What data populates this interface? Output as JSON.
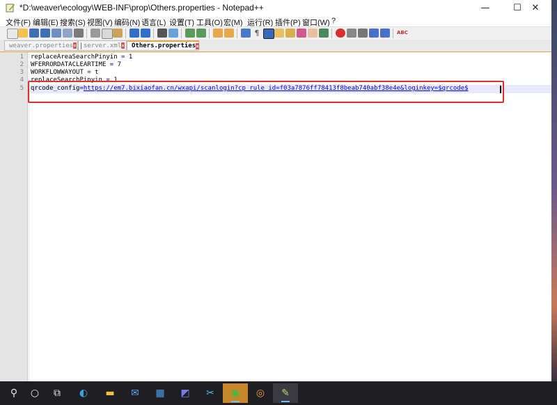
{
  "window": {
    "title": "*D:\\weaver\\ecology\\WEB-INF\\prop\\Others.properties - Notepad++",
    "minimize": "—",
    "maximize": "☐",
    "close": "✕"
  },
  "menu": [
    "文件(F)",
    "编辑(E)",
    "搜索(S)",
    "视图(V)",
    "编码(N)",
    "语言(L)",
    "设置(T)",
    "工具(O)",
    "宏(M)",
    "运行(R)",
    "插件(P)",
    "窗口(W)",
    "?"
  ],
  "tabs": [
    {
      "label": "weaver.properties"
    },
    {
      "label": "server.xml"
    },
    {
      "label": "Others.properties"
    }
  ],
  "editor": {
    "line_numbers": [
      "1",
      "2",
      "3",
      "4",
      "5"
    ],
    "lines": [
      {
        "key": "replaceAreaSearchPinyin",
        "op": " = ",
        "value": "1"
      },
      {
        "key": "WFERRORDATACLEARTIME",
        "op": " = ",
        "value": "7"
      },
      {
        "key": "WORKFLOWWAYOUT",
        "op": " = ",
        "value": "t"
      },
      {
        "key": "replaceSearchPinyin",
        "op": " = ",
        "value": "1"
      },
      {
        "key": "qrcode_config",
        "op": "=",
        "value": "https://em7.bixiaofan.cn/wxapi/scanlogin?cp_rule_id=f03a7876ff78413f8beab740abf38e4e&loginkey=$qrcode$"
      }
    ]
  },
  "colors": {
    "highlight_border": "#e0302a",
    "active_tab_accent": "#f0a040",
    "link": "#0000ff"
  },
  "taskbar": {
    "items": [
      {
        "icon": "search-icon",
        "glyph": "⚲"
      },
      {
        "icon": "start-circle-icon",
        "glyph": "○"
      },
      {
        "icon": "task-view-icon",
        "glyph": "⧉"
      },
      {
        "icon": "edge-icon",
        "glyph": "◐"
      },
      {
        "icon": "folder-icon",
        "glyph": "▬"
      },
      {
        "icon": "mail-icon",
        "glyph": "✉"
      },
      {
        "icon": "store-icon",
        "glyph": "▦"
      },
      {
        "icon": "editor-app-icon",
        "glyph": "◩"
      },
      {
        "icon": "snip-icon",
        "glyph": "✂"
      },
      {
        "icon": "wechat-icon",
        "glyph": "◉"
      },
      {
        "icon": "chrome-icon",
        "glyph": "◎"
      },
      {
        "icon": "notepadpp-icon",
        "glyph": "✎"
      }
    ]
  }
}
